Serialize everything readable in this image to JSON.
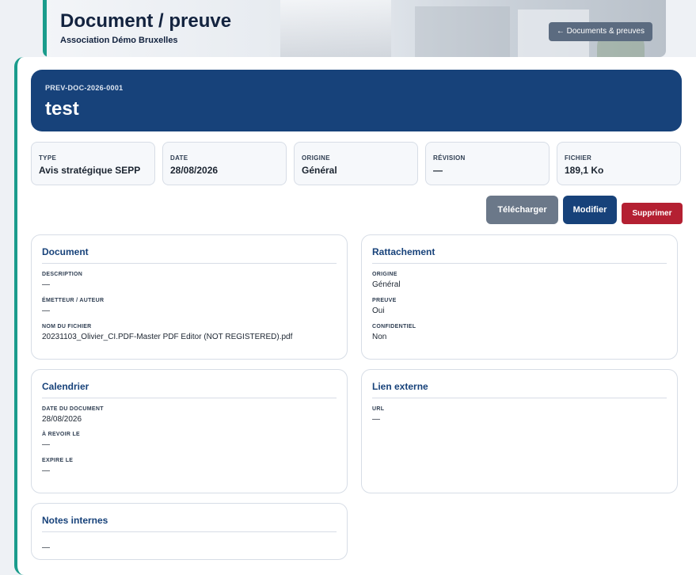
{
  "header": {
    "title": "Document / preuve",
    "subtitle": "Association Démo Bruxelles",
    "back_label": "← Documents & preuves"
  },
  "document": {
    "reference": "PREV-DOC-2026-0001",
    "title": "test"
  },
  "meta": [
    {
      "label": "TYPE",
      "value": "Avis stratégique SEPP"
    },
    {
      "label": "DATE",
      "value": "28/08/2026"
    },
    {
      "label": "ORIGINE",
      "value": "Général"
    },
    {
      "label": "RÉVISION",
      "value": "—"
    },
    {
      "label": "FICHIER",
      "value": "189,1 Ko"
    }
  ],
  "actions": {
    "download": "Télécharger",
    "edit": "Modifier",
    "delete": "Supprimer"
  },
  "sections": {
    "document": {
      "title": "Document",
      "fields": [
        {
          "label": "DESCRIPTION",
          "value": "—"
        },
        {
          "label": "ÉMETTEUR / AUTEUR",
          "value": "—"
        },
        {
          "label": "NOM DU FICHIER",
          "value": "20231103_Olivier_CI.PDF-Master PDF Editor (NOT REGISTERED).pdf"
        }
      ]
    },
    "rattachement": {
      "title": "Rattachement",
      "fields": [
        {
          "label": "ORIGINE",
          "value": "Général"
        },
        {
          "label": "PREUVE",
          "value": "Oui"
        },
        {
          "label": "CONFIDENTIEL",
          "value": "Non"
        }
      ]
    },
    "calendrier": {
      "title": "Calendrier",
      "fields": [
        {
          "label": "DATE DU DOCUMENT",
          "value": "28/08/2026"
        },
        {
          "label": "À REVOIR LE",
          "value": "—"
        },
        {
          "label": "EXPIRE LE",
          "value": "—"
        }
      ]
    },
    "lien": {
      "title": "Lien externe",
      "fields": [
        {
          "label": "URL",
          "value": "—"
        }
      ]
    },
    "notes": {
      "title": "Notes internes",
      "value": "—"
    }
  },
  "colors": {
    "accent": "#1a9c8c",
    "primary": "#17427a",
    "danger": "#b42032",
    "secondary": "#6b7889"
  }
}
